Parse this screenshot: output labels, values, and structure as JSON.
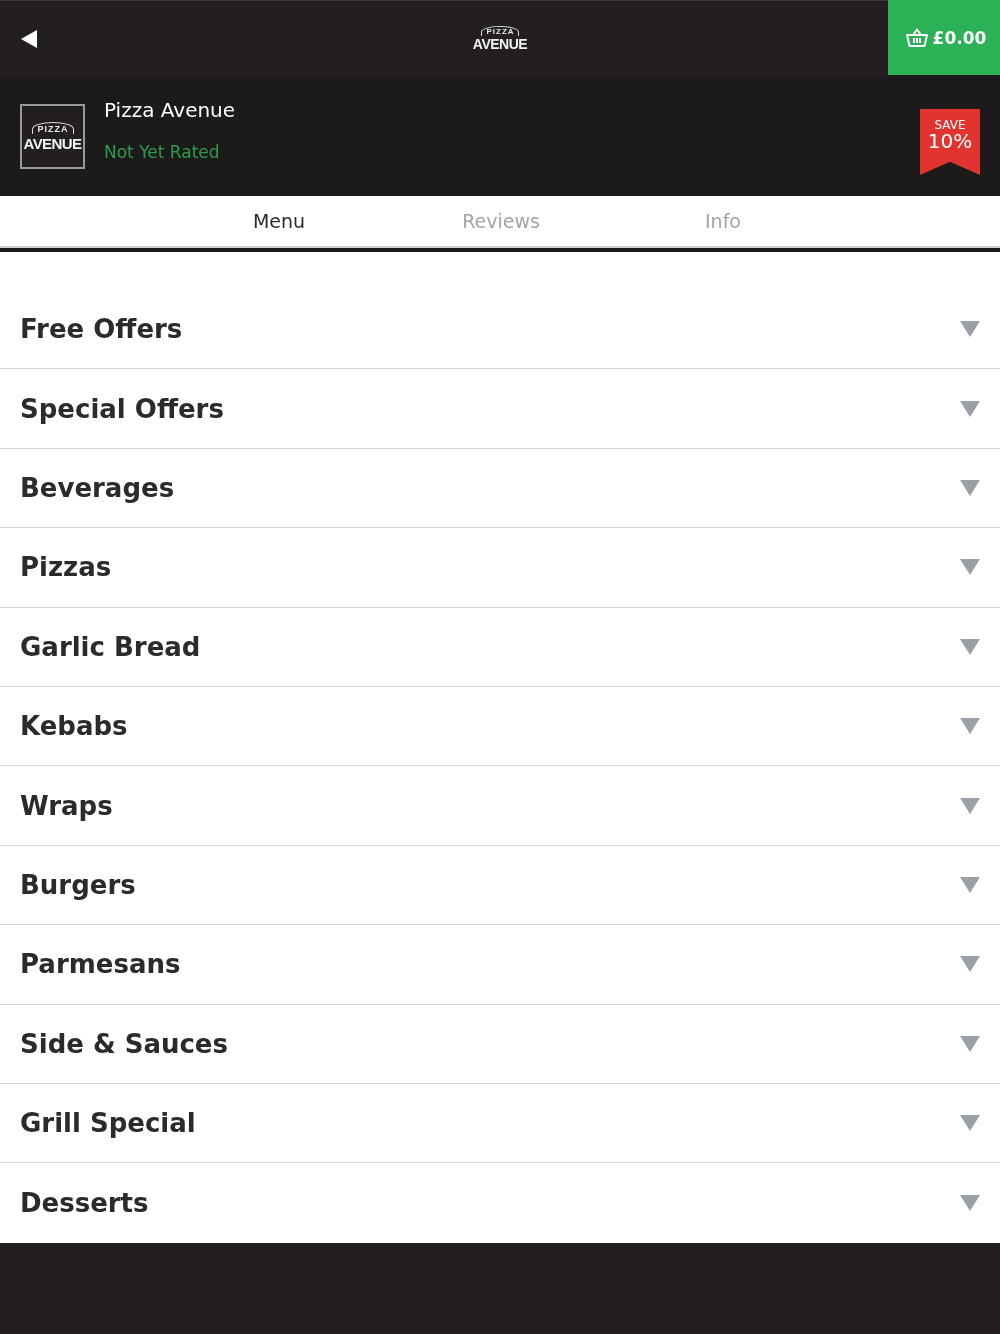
{
  "top_bar": {
    "logo": {
      "top_text": "PIZZA",
      "main_text": "AVENUE"
    },
    "cart": {
      "total": "£0.00"
    }
  },
  "restaurant": {
    "logo": {
      "top_text": "PIZZA",
      "main_text": "AVENUE"
    },
    "name": "Pizza Avenue",
    "rating": "Not Yet Rated",
    "badge": {
      "line_1": "SAVE",
      "line_2": "10%"
    }
  },
  "tabs": [
    {
      "label": "Menu",
      "selected": true
    },
    {
      "label": "Reviews",
      "selected": false
    },
    {
      "label": "Info",
      "selected": false
    }
  ],
  "categories": [
    {
      "label": "Free Offers",
      "expanded": false
    },
    {
      "label": "Special Offers",
      "expanded": false
    },
    {
      "label": "Beverages",
      "expanded": false
    },
    {
      "label": "Pizzas",
      "expanded": false
    },
    {
      "label": "Garlic Bread",
      "expanded": false
    },
    {
      "label": "Kebabs",
      "expanded": false
    },
    {
      "label": "Wraps",
      "expanded": false
    },
    {
      "label": "Burgers",
      "expanded": false
    },
    {
      "label": "Parmesans",
      "expanded": false
    },
    {
      "label": "Side & Sauces",
      "expanded": false
    },
    {
      "label": "Grill Special",
      "expanded": false
    },
    {
      "label": "Desserts",
      "expanded": false
    }
  ]
}
